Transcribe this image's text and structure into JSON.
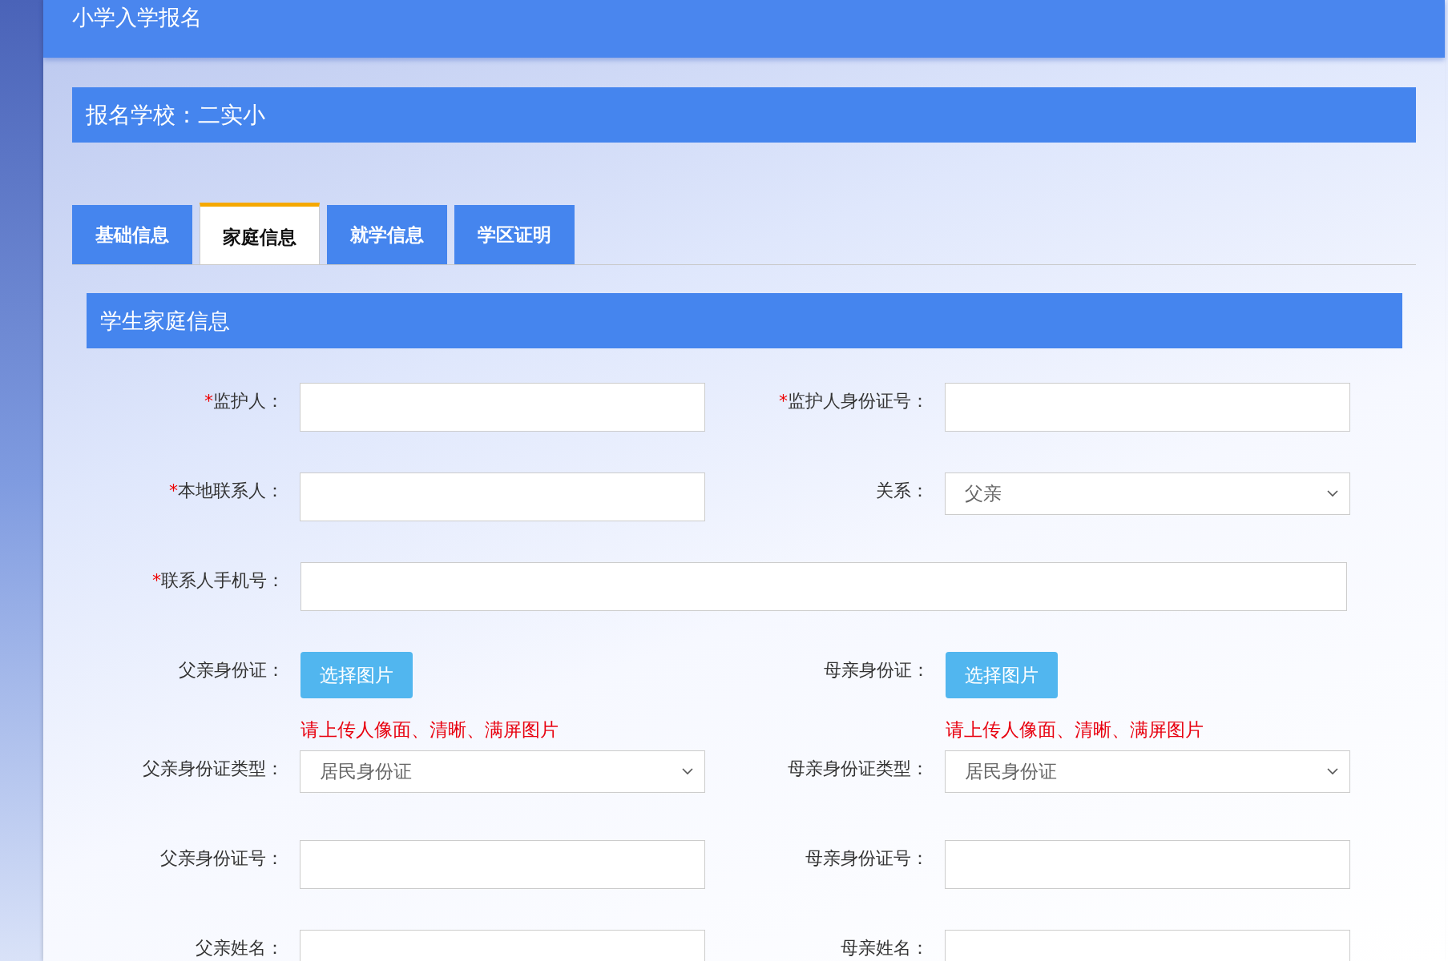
{
  "header": {
    "title": "小学入学报名"
  },
  "school_bar": {
    "text": "报名学校：二实小"
  },
  "tabs": [
    {
      "label": "基础信息",
      "selected": false
    },
    {
      "label": "家庭信息",
      "selected": true
    },
    {
      "label": "就学信息",
      "selected": false
    },
    {
      "label": "学区证明",
      "selected": false
    }
  ],
  "section": {
    "title": "学生家庭信息"
  },
  "rows": [
    {
      "fields": [
        {
          "kind": "text",
          "label": "监护人：",
          "required_mark": "*"
        },
        {
          "kind": "text",
          "label": "监护人身份证号：",
          "required_mark": "*"
        }
      ]
    },
    {
      "fields": [
        {
          "kind": "text",
          "label": "本地联系人：",
          "required_mark": "*"
        },
        {
          "kind": "select",
          "label": "关系：",
          "value": "父亲"
        }
      ]
    },
    {
      "fields": [
        {
          "kind": "wide",
          "label": "联系人手机号：",
          "required_mark": "*"
        }
      ]
    },
    {
      "fields": [
        {
          "kind": "upload",
          "label": "父亲身份证：",
          "button": "选择图片",
          "hint": "请上传人像面、清晰、满屏图片"
        },
        {
          "kind": "upload",
          "label": "母亲身份证：",
          "button": "选择图片",
          "hint": "请上传人像面、清晰、满屏图片"
        }
      ]
    },
    {
      "fields": [
        {
          "kind": "select",
          "label": "父亲身份证类型：",
          "value": "居民身份证"
        },
        {
          "kind": "select",
          "label": "母亲身份证类型：",
          "value": "居民身份证"
        }
      ]
    },
    {
      "fields": [
        {
          "kind": "text",
          "label": "父亲身份证号："
        },
        {
          "kind": "text",
          "label": "母亲身份证号："
        }
      ]
    },
    {
      "fields": [
        {
          "kind": "text",
          "label": "父亲姓名："
        },
        {
          "kind": "text",
          "label": "母亲姓名："
        }
      ]
    }
  ]
}
